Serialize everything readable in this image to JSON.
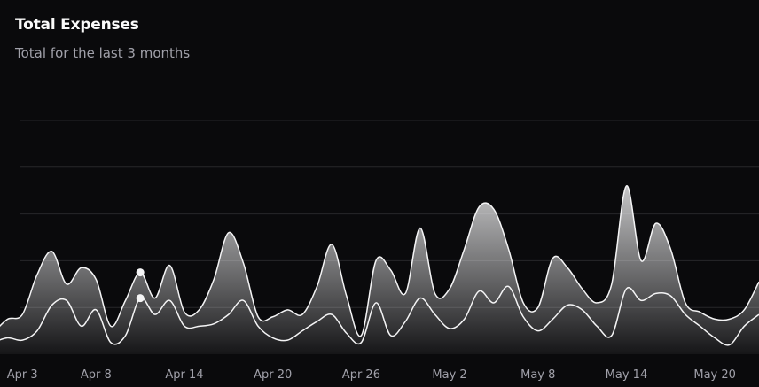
{
  "header": {
    "title": "Total Expenses",
    "subtitle": "Total for the last 3 months"
  },
  "colors": {
    "background": "#0a0a0c",
    "line": "#f4f4f5",
    "grid": "#27272a",
    "tick": "#a1a1aa"
  },
  "chart_data": {
    "type": "area",
    "stacked": true,
    "grid": "horizontal",
    "legend": "none",
    "ylim": [
      0,
      1000
    ],
    "x_tick_labels": [
      "Apr 3",
      "Apr 8",
      "Apr 14",
      "Apr 20",
      "Apr 26",
      "May 2",
      "May 8",
      "May 14",
      "May 20"
    ],
    "x_tick_index": [
      2,
      7,
      13,
      19,
      25,
      31,
      37,
      43,
      49
    ],
    "active_index": 10,
    "series": [
      {
        "values": [
          50,
          70,
          60,
          100,
          210,
          230,
          120,
          190,
          50,
          80,
          240,
          170,
          230,
          120,
          120,
          130,
          170,
          230,
          120,
          70,
          60,
          100,
          140,
          170,
          90,
          50,
          220,
          80,
          140,
          240,
          170,
          110,
          150,
          270,
          220,
          290,
          160,
          100,
          150,
          210,
          190,
          120,
          80,
          280,
          230,
          260,
          250,
          170,
          120,
          70,
          40,
          120,
          170
        ]
      },
      {
        "values": [
          40,
          80,
          110,
          240,
          230,
          70,
          250,
          130,
          70,
          150,
          110,
          70,
          150,
          60,
          70,
          190,
          350,
          160,
          40,
          90,
          130,
          70,
          150,
          300,
          160,
          30,
          180,
          280,
          120,
          300,
          90,
          170,
          300,
          360,
          400,
          160,
          60,
          100,
          260,
          160,
          90,
          100,
          220,
          440,
          170,
          300,
          200,
          50,
          60,
          80,
          110,
          70,
          140
        ]
      }
    ]
  }
}
